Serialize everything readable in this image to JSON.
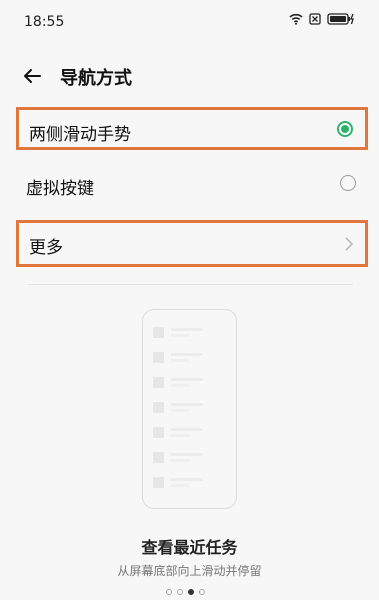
{
  "status_bar": {
    "time": "18:55",
    "icons": [
      "wifi-icon",
      "sim-off-icon",
      "battery-charging-icon"
    ]
  },
  "header": {
    "back_icon": "arrow-left-icon",
    "title": "导航方式"
  },
  "options": [
    {
      "label": "两侧滑动手势",
      "selected": true
    },
    {
      "label": "虚拟按键",
      "selected": false
    }
  ],
  "more": {
    "label": "更多",
    "icon": "chevron-right-icon"
  },
  "preview": {
    "title": "查看最近任务",
    "subtitle": "从屏幕底部向上滑动并停留",
    "page_count": 4,
    "current_page": 3
  },
  "colors": {
    "accent": "#2fb36a",
    "highlight_box": "#e1773c",
    "background": "#f7f7f7"
  }
}
